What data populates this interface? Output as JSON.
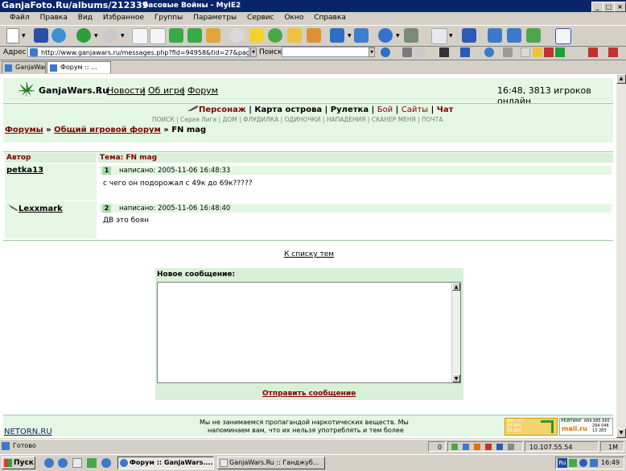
{
  "watermark": "GanjaFoto.Ru/albums/212339",
  "window": {
    "title": "басовые Войны - MyIE2",
    "btn_min": "_",
    "btn_max": "□",
    "btn_close": "×"
  },
  "menu": [
    "Файл",
    "Правка",
    "Вид",
    "Избранное",
    "Группы",
    "Параметры",
    "Сервис",
    "Окно",
    "Справка"
  ],
  "address": {
    "label": "Адрес",
    "url": "http://www.ganjawars.ru/messages.php?fid=94958&tid=27&page_id",
    "search_label": "Поиск"
  },
  "tabs": [
    {
      "label": "GanjaWar"
    },
    {
      "label": "Форум :: ..."
    }
  ],
  "site": {
    "logo": "GanjaWars.Ru",
    "logo_sep": ":",
    "nav": [
      "Новости",
      "Об игре",
      "Форум"
    ],
    "online": "16:48, 3813 игроков онлайн",
    "main_menu": [
      "Персонаж",
      "Карта острова",
      "Рулетка",
      "Бой",
      "Сайты",
      "Чат"
    ],
    "sub_menu": [
      "ПОИСК",
      "Серая Лига",
      "ДОМ",
      "ФЛУДИЛКА",
      "ОДИНОЧКИ",
      "НАПАДЕНИЯ",
      "СКАНЕР МЕНЯ",
      "ПОЧТА"
    ],
    "breadcrumb": {
      "forums": "Форумы",
      "forum": "Общий игровой форум",
      "sep": "»",
      "topic": "FN mag"
    }
  },
  "thread": {
    "author_header": "Автор",
    "topic_header": "Тема: FN mag",
    "posts": [
      {
        "author": "petka13",
        "num": "1",
        "meta": "написано: 2005-11-06 16:48:33",
        "text": "с чего он подорожал с 49к до 69к?????"
      },
      {
        "author": "Lexxmark",
        "num": "2",
        "meta": "написано: 2005-11-06 16:48:40",
        "text": "ДВ это боян"
      }
    ],
    "back_link": "К списку тем"
  },
  "reply": {
    "title": "Новое сообщение:",
    "submit": "Отправить сообщение"
  },
  "footer": {
    "netorn": "NETORN.RU",
    "disclaimer_line1": "Мы не занимаемся пропагандой наркотических веществ. Мы",
    "disclaimer_line2": "напоминаем вам, что их нельзя употреблять и тем более",
    "counter1": [
      "606 777",
      "14 984",
      "13 595"
    ],
    "counter2_label": "РЕЙТИНГ",
    "counter2_values": [
      "689 885 665",
      "294 046",
      "13 283"
    ],
    "counter2_logo": "mail.ru"
  },
  "status": {
    "text": "Готово",
    "count": "0",
    "ip": "10.107.55.54",
    "mem": "1M"
  },
  "taskbar": {
    "start": "Пуск",
    "tasks": [
      "Форум :: GanjaWars....",
      "GanjaWars.Ru :: Ганджуб..."
    ],
    "lang": "Ru",
    "time": "16:49"
  },
  "colors": {
    "green_bg": "#e4f7e4",
    "dark_red": "#800000",
    "title_blue": "#0a246a"
  }
}
